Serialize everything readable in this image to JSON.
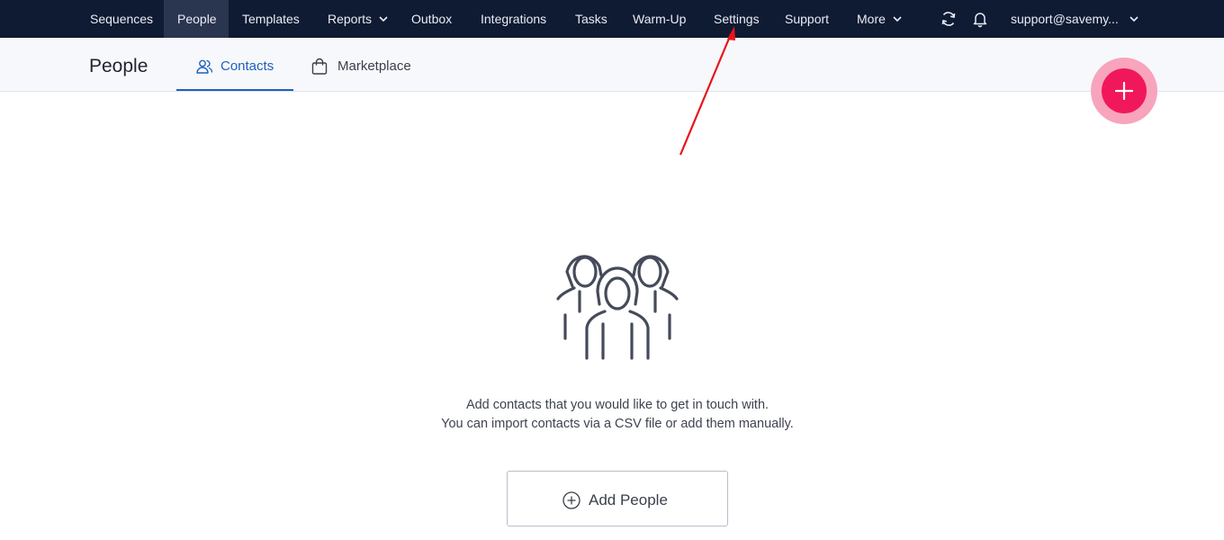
{
  "nav": {
    "items": [
      {
        "label": "Sequences"
      },
      {
        "label": "People"
      },
      {
        "label": "Templates"
      },
      {
        "label": "Reports"
      },
      {
        "label": "Outbox"
      },
      {
        "label": "Integrations"
      },
      {
        "label": "Tasks"
      },
      {
        "label": "Warm-Up"
      },
      {
        "label": "Settings"
      },
      {
        "label": "Support"
      },
      {
        "label": "More"
      }
    ],
    "active": "People",
    "account": "support@savemy..."
  },
  "subheader": {
    "title": "People",
    "tabs": [
      {
        "label": "Contacts"
      },
      {
        "label": "Marketplace"
      }
    ],
    "active_tab": "Contacts"
  },
  "empty_state": {
    "line1": "Add contacts that you would like to get in touch with.",
    "line2": "You can import contacts via a CSV file or add them manually.",
    "button_label": "Add People"
  },
  "icons": {
    "refresh": "refresh-icon",
    "notifications": "bell-icon",
    "contacts_tab": "people-icon",
    "marketplace_tab": "shopping-bag-icon",
    "fab": "plus-icon",
    "add_button": "plus-circle-icon",
    "illustration": "people-group-icon"
  },
  "colors": {
    "nav_bg": "#0f1a33",
    "accent": "#1f5fbf",
    "fab": "#f0185a",
    "annotation_arrow": "#e8141c"
  }
}
